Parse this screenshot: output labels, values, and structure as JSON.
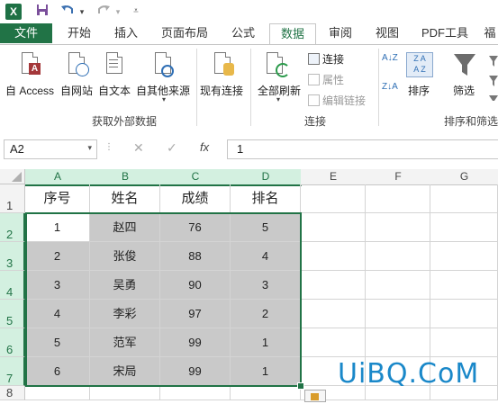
{
  "qat": {
    "logo": "X",
    "save_icon": "save-icon",
    "undo_icon": "undo-icon",
    "redo_icon": "redo-icon",
    "more_icon": "customize-icon"
  },
  "tabs": [
    {
      "label": "文件"
    },
    {
      "label": "开始"
    },
    {
      "label": "插入"
    },
    {
      "label": "页面布局"
    },
    {
      "label": "公式"
    },
    {
      "label": "数据"
    },
    {
      "label": "审阅"
    },
    {
      "label": "视图"
    },
    {
      "label": "PDF工具"
    },
    {
      "label": "福"
    }
  ],
  "ribbon": {
    "from_access": "自 Access",
    "from_web": "自网站",
    "from_text": "自文本",
    "from_other": "自其他来源",
    "existing_conn": "现有连接",
    "group_external": "获取外部数据",
    "refresh_all": "全部刷新",
    "connections": "连接",
    "properties": "属性",
    "edit_links": "编辑链接",
    "group_connections": "连接",
    "sort_az": "A↓Z",
    "sort_za": "Z↓A",
    "sort": "排序",
    "filter": "筛选",
    "group_sort": "排序和筛选"
  },
  "formula_bar": {
    "name_box": "A2",
    "cancel": "✕",
    "enter": "✓",
    "fx": "fx",
    "value": "1"
  },
  "columns": [
    "A",
    "B",
    "C",
    "D",
    "E",
    "F",
    "G"
  ],
  "rows": [
    "1",
    "2",
    "3",
    "4",
    "5",
    "6",
    "7",
    "8"
  ],
  "table": {
    "headers": [
      "序号",
      "姓名",
      "成绩",
      "排名"
    ],
    "data": [
      [
        "1",
        "赵四",
        "76",
        "5"
      ],
      [
        "2",
        "张俊",
        "88",
        "4"
      ],
      [
        "3",
        "吴勇",
        "90",
        "3"
      ],
      [
        "4",
        "李彩",
        "97",
        "2"
      ],
      [
        "5",
        "范军",
        "99",
        "1"
      ],
      [
        "6",
        "宋局",
        "99",
        "1"
      ]
    ]
  },
  "watermark": "UiBQ.CoM",
  "colors": {
    "accent": "#217346",
    "selection_fill": "#c9c9c9",
    "watermark": "#1a88c9"
  }
}
